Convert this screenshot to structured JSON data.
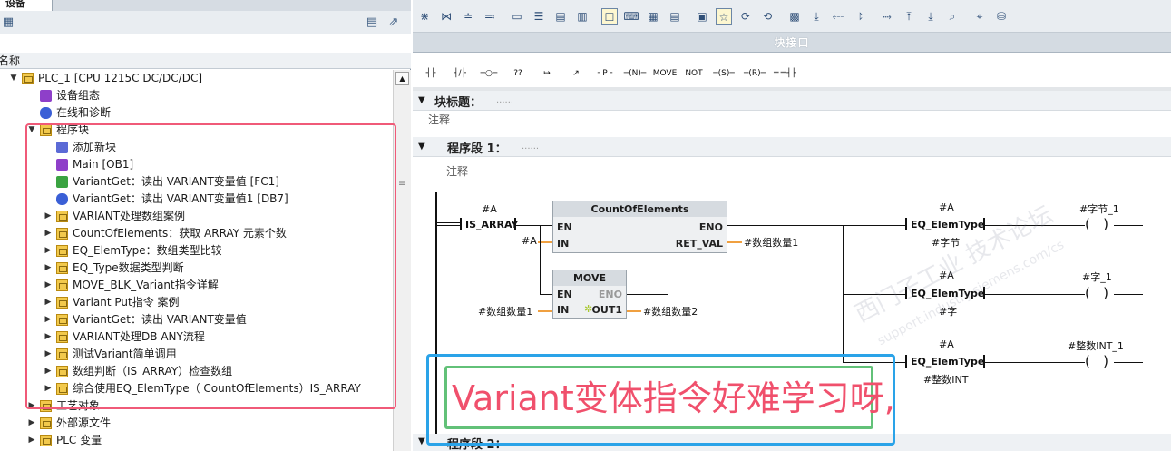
{
  "left": {
    "tab": "设备",
    "column_header": "名称",
    "tree": [
      {
        "label": "PLC_1 [CPU 1215C DC/DC/DC]",
        "depth": 0,
        "toggle": "▼",
        "icon": "plc-icon"
      },
      {
        "label": "设备组态",
        "depth": 1,
        "toggle": "",
        "icon": "device-config-icon"
      },
      {
        "label": "在线和诊断",
        "depth": 1,
        "toggle": "",
        "icon": "online-diag-icon"
      },
      {
        "label": "程序块",
        "depth": 1,
        "toggle": "▼",
        "icon": "program-blocks-icon"
      },
      {
        "label": "添加新块",
        "depth": 2,
        "toggle": "",
        "icon": "add-block-icon"
      },
      {
        "label": "Main [OB1]",
        "depth": 2,
        "toggle": "",
        "icon": "ob-icon"
      },
      {
        "label": "VariantGet：读出 VARIANT变量值 [FC1]",
        "depth": 2,
        "toggle": "",
        "icon": "fc-icon"
      },
      {
        "label": "VariantGet：读出 VARIANT变量值1 [DB7]",
        "depth": 2,
        "toggle": "",
        "icon": "db-icon"
      },
      {
        "label": " VARIANT处理数组案例",
        "depth": 2,
        "toggle": "▶",
        "icon": "folder-icon"
      },
      {
        "label": "CountOfElements：获取 ARRAY 元素个数",
        "depth": 2,
        "toggle": "▶",
        "icon": "folder-icon"
      },
      {
        "label": "EQ_ElemType：数组类型比较",
        "depth": 2,
        "toggle": "▶",
        "icon": "folder-icon"
      },
      {
        "label": "EQ_Type数据类型判断",
        "depth": 2,
        "toggle": "▶",
        "icon": "folder-icon"
      },
      {
        "label": "MOVE_BLK_Variant指令详解",
        "depth": 2,
        "toggle": "▶",
        "icon": "folder-icon"
      },
      {
        "label": "Variant Put指令  案例",
        "depth": 2,
        "toggle": "▶",
        "icon": "folder-icon"
      },
      {
        "label": "VariantGet：读出 VARIANT变量值",
        "depth": 2,
        "toggle": "▶",
        "icon": "folder-icon"
      },
      {
        "label": "VARIANT处理DB ANY流程",
        "depth": 2,
        "toggle": "▶",
        "icon": "folder-icon"
      },
      {
        "label": "测试Variant简单调用",
        "depth": 2,
        "toggle": "▶",
        "icon": "folder-icon"
      },
      {
        "label": "数组判断（IS_ARRAY）检查数组",
        "depth": 2,
        "toggle": "▶",
        "icon": "folder-icon"
      },
      {
        "label": "综合使用EQ_ElemType（ CountOfElements）IS_ARRAY",
        "depth": 2,
        "toggle": "▶",
        "icon": "folder-icon"
      },
      {
        "label": "工艺对象",
        "depth": 1,
        "toggle": "▶",
        "icon": "tech-object-icon"
      },
      {
        "label": "外部源文件",
        "depth": 1,
        "toggle": "▶",
        "icon": "ext-source-icon"
      },
      {
        "label": "PLC 变量",
        "depth": 1,
        "toggle": "▶",
        "icon": "plc-tags-icon"
      }
    ]
  },
  "right": {
    "interface_label": "块接口",
    "ladder_palette": [
      "┤├",
      "┤/├",
      "─○─",
      "??",
      "↦",
      "↗",
      "┤P├",
      "─(N)─",
      "MOVE",
      "NOT",
      "─(S)─",
      "─(R)─",
      "==┤├"
    ],
    "block_title": {
      "title": "块标题：",
      "dots": "......",
      "comment": "注释"
    },
    "network1": {
      "title": "程序段 1：",
      "dots": "......",
      "comment": "注释"
    },
    "network2": {
      "title": "程序段 2：",
      "dots": "......"
    },
    "rung1": {
      "contact_var": "#A",
      "contact_name": "IS_ARRAY",
      "box_title": "CountOfElements",
      "en": "EN",
      "eno": "ENO",
      "in_pin": "IN",
      "in_var": "#A",
      "out_pin": "RET_VAL",
      "out_var": "#数组数量1",
      "cmp1_var": "#A",
      "cmp1_name": "EQ_ElemType",
      "cmp1_type": "#字节",
      "coil1_var": "#字节_1"
    },
    "rung2": {
      "box_title": "MOVE",
      "en": "EN",
      "eno": "ENO",
      "in_pin": "IN",
      "in_var": "#数组数量1",
      "out_pin": "OUT1",
      "out_var": "#数组数量2",
      "cmp2_var": "#A",
      "cmp2_name": "EQ_ElemType",
      "cmp2_type": "#字",
      "coil2_var": "#字_1"
    },
    "rung3": {
      "cmp3_var": "#A",
      "cmp3_name": "EQ_ElemType",
      "cmp3_type": "#整数INT",
      "coil3_var": "#整数INT_1"
    },
    "watermark": "西门子工业 技术论坛",
    "watermark_url": "support.industry.siemens.com/cs",
    "overlay_text": "Variant变体指令好难学习呀,"
  }
}
